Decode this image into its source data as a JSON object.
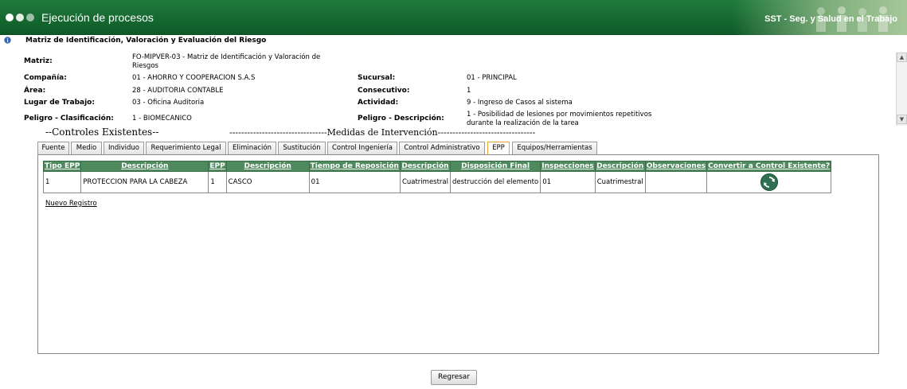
{
  "window": {
    "title": "Ejecución de procesos",
    "brand": "SST - Seg. y Salud en el Trabajo"
  },
  "page": {
    "title": "Matriz de Identificación, Valoración y Evaluación del Riesgo"
  },
  "fields": {
    "matriz": {
      "label": "Matriz:",
      "value": "FO-MIPVER-03 - Matriz de Identificación y Valoración de Riesgos"
    },
    "compania": {
      "label": "Compañía:",
      "value": "01 - AHORRO Y COOPERACION S.A.S"
    },
    "sucursal": {
      "label": "Sucursal:",
      "value": "01 - PRINCIPAL"
    },
    "area": {
      "label": "Área:",
      "value": "28 - AUDITORIA CONTABLE"
    },
    "consecutivo": {
      "label": "Consecutivo:",
      "value": "1"
    },
    "lugar": {
      "label": "Lugar de Trabajo:",
      "value": "03 - Oficina Auditoria"
    },
    "actividad": {
      "label": "Actividad:",
      "value": "9 - Ingreso de Casos al sistema"
    },
    "peligro_clasificacion": {
      "label": "Peligro - Clasificación:",
      "value": "1 - BIOMECANICO"
    },
    "peligro_descripcion": {
      "label": "Peligro - Descripción:",
      "value": "1 - Posibilidad de lesiones por movimientos repetitivos durante la realización de la tarea"
    }
  },
  "sections": {
    "controles": "--Controles Existentes--",
    "medidas": "---------------------------------Medidas de Intervención---------------------------------"
  },
  "tabs": [
    {
      "label": "Fuente"
    },
    {
      "label": "Medio"
    },
    {
      "label": "Individuo"
    },
    {
      "label": "Requerimiento Legal"
    },
    {
      "label": "Eliminación"
    },
    {
      "label": "Sustitución"
    },
    {
      "label": "Control Ingeniería"
    },
    {
      "label": "Control Administrativo"
    },
    {
      "label": "EPP",
      "active": true
    },
    {
      "label": "Equipos/Herramientas"
    }
  ],
  "table": {
    "headers": [
      "Tipo EPP",
      "Descripción",
      "EPP",
      "Descripción",
      "Tiempo de Reposición",
      "Descripción",
      "Disposición Final",
      "Inspecciones",
      "Descripción",
      "Observaciones",
      "Convertir a Control Existente?"
    ],
    "rows": [
      [
        "1",
        "PROTECCION PARA LA CABEZA",
        "1",
        "CASCO",
        "01",
        "Cuatrimestral",
        "destrucción del elemento",
        "01",
        "Cuatrimestral",
        ""
      ]
    ],
    "convert_icon": "refresh-icon"
  },
  "links": {
    "nuevo_registro": "Nuevo Registro"
  },
  "buttons": {
    "regresar": "Regresar"
  },
  "icons": {
    "info": "info-icon"
  },
  "colors": {
    "titlebar": "#1f7a3c",
    "header": "#4e8a5e",
    "active_tab_border": "#e8a23a"
  }
}
